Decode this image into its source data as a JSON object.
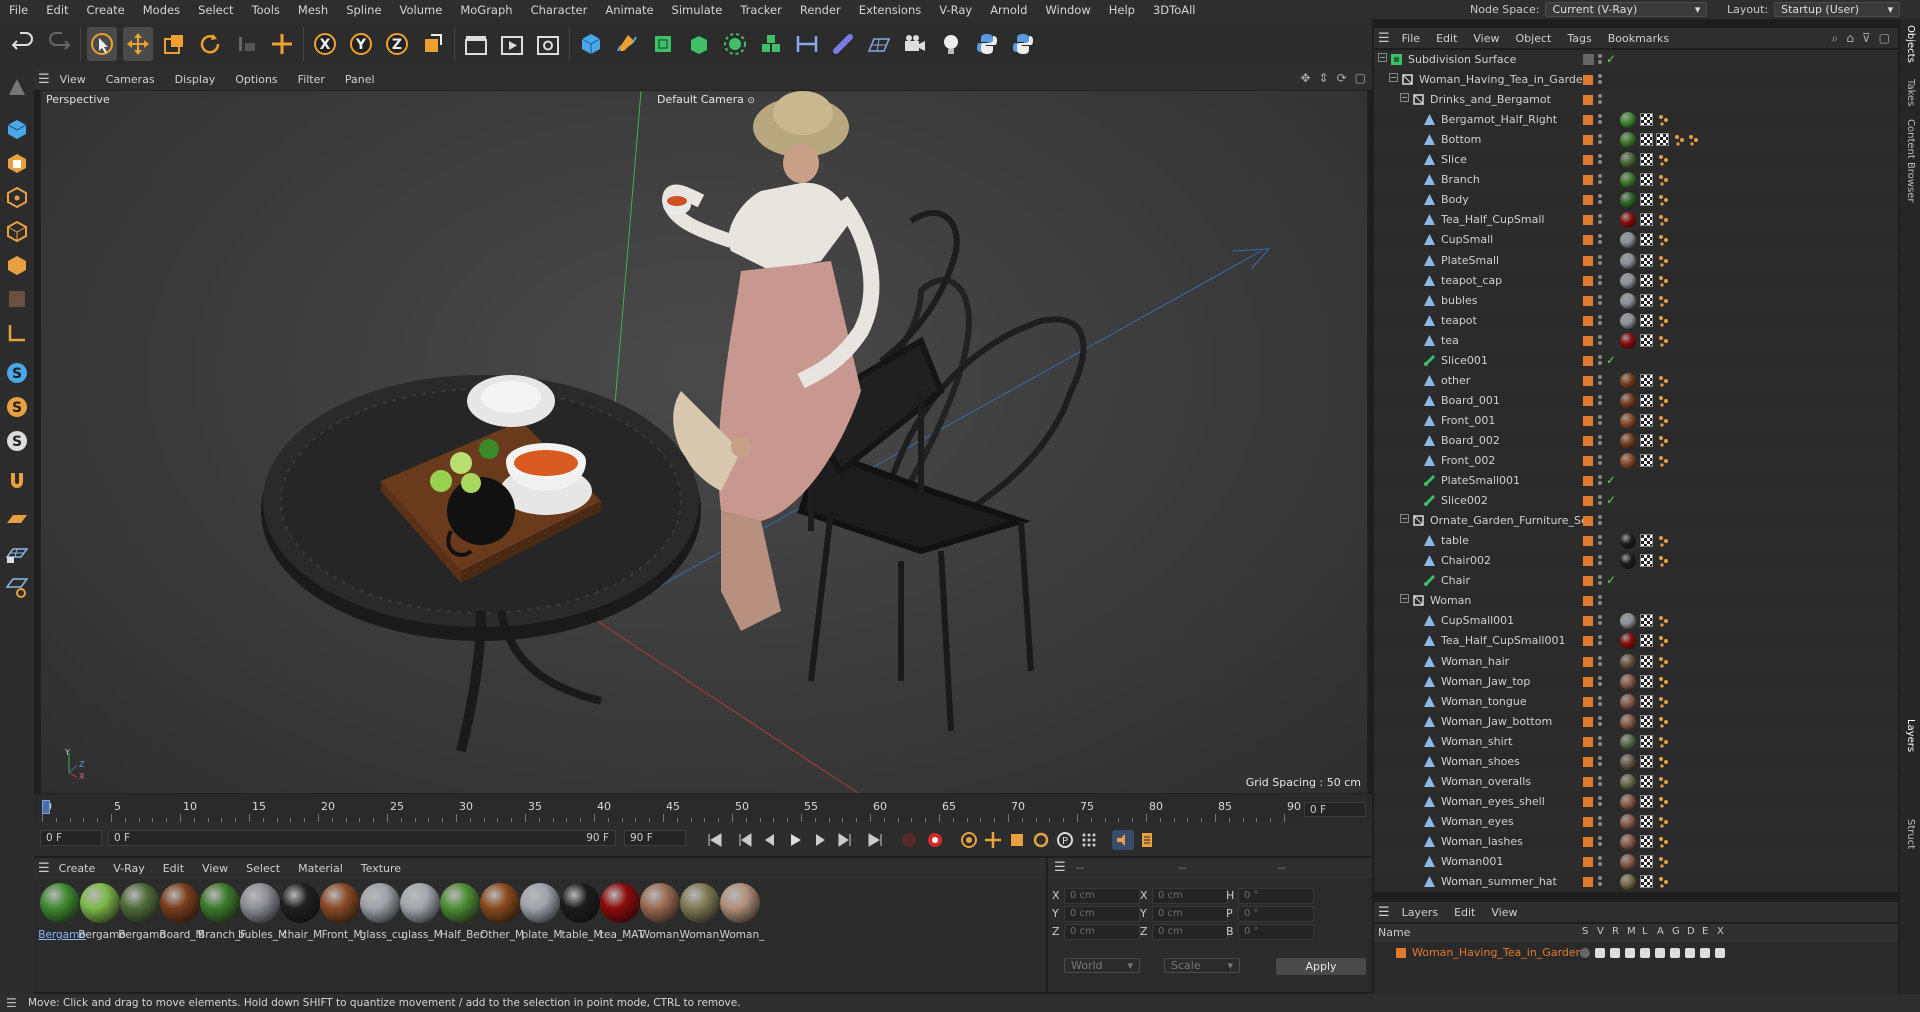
{
  "menubar": {
    "items": [
      "File",
      "Edit",
      "Create",
      "Modes",
      "Select",
      "Tools",
      "Mesh",
      "Spline",
      "Volume",
      "MoGraph",
      "Character",
      "Animate",
      "Simulate",
      "Tracker",
      "Render",
      "Extensions",
      "V-Ray",
      "Arnold",
      "Window",
      "Help",
      "3DToAll"
    ],
    "node_space_label": "Node Space:",
    "node_space_value": "Current (V-Ray)",
    "layout_label": "Layout:",
    "layout_value": "Startup (User)"
  },
  "viewport": {
    "menu": [
      "View",
      "Cameras",
      "Display",
      "Options",
      "Filter",
      "Panel"
    ],
    "label": "Perspective",
    "camera": "Default Camera",
    "grid_spacing": "Grid Spacing : 50 cm"
  },
  "timeline": {
    "ticks": [
      "0",
      "5",
      "10",
      "15",
      "20",
      "25",
      "30",
      "35",
      "40",
      "45",
      "50",
      "55",
      "60",
      "65",
      "70",
      "75",
      "80",
      "85",
      "90"
    ],
    "current_frame": "0 F",
    "start_field": "0 F",
    "range_start": "0 F",
    "range_end": "90 F",
    "end_field": "90 F"
  },
  "materials": {
    "menu": [
      "Create",
      "V-Ray",
      "Edit",
      "View",
      "Select",
      "Material",
      "Texture"
    ],
    "items": [
      {
        "name": "Bergamo",
        "color": "#3f8a2f"
      },
      {
        "name": "Bergamo",
        "color": "#7db84a"
      },
      {
        "name": "Bergamo",
        "color": "#4f6b3a"
      },
      {
        "name": "Board_M",
        "color": "#7a3e1e"
      },
      {
        "name": "Branch_F",
        "color": "#3d7a2c"
      },
      {
        "name": "bubles_M",
        "color": "#8e8e96"
      },
      {
        "name": "chair_M",
        "color": "#202020"
      },
      {
        "name": "Front_M",
        "color": "#8a4a26"
      },
      {
        "name": "glass_cu",
        "color": "#9ea2a8"
      },
      {
        "name": "glass_M",
        "color": "#a4a8ae"
      },
      {
        "name": "Half_Ber",
        "color": "#4e8e34"
      },
      {
        "name": "Other_M",
        "color": "#8a4a1e"
      },
      {
        "name": "plate_M",
        "color": "#a0a4ac"
      },
      {
        "name": "table_M",
        "color": "#1c1c1c"
      },
      {
        "name": "tea_MAT",
        "color": "#8e0a0a"
      },
      {
        "name": "Woman_",
        "color": "#9a6a52"
      },
      {
        "name": "Woman_",
        "color": "#7f7a55"
      },
      {
        "name": "Woman_",
        "color": "#b0907a"
      }
    ]
  },
  "coordinates": {
    "headers": [
      "--",
      "--",
      "--"
    ],
    "rows": [
      {
        "a": "X",
        "av": "0 cm",
        "b": "X",
        "bv": "0 cm",
        "c": "H",
        "cv": "0 °"
      },
      {
        "a": "Y",
        "av": "0 cm",
        "b": "Y",
        "bv": "0 cm",
        "c": "P",
        "cv": "0 °"
      },
      {
        "a": "Z",
        "av": "0 cm",
        "b": "Z",
        "bv": "0 cm",
        "c": "B",
        "cv": "0 °"
      }
    ],
    "world": "World",
    "scale": "Scale",
    "apply": "Apply"
  },
  "status": "Move: Click and drag to move elements. Hold down SHIFT to quantize movement / add to the selection in point mode, CTRL to remove.",
  "object_manager": {
    "menu": [
      "File",
      "Edit",
      "View",
      "Object",
      "Tags",
      "Bookmarks"
    ],
    "rows": [
      {
        "label": "Subdivision Surface",
        "indent": 0,
        "type": "subd",
        "tags": []
      },
      {
        "label": "Woman_Having_Tea_in_Garden",
        "indent": 1,
        "type": "null",
        "tags": []
      },
      {
        "label": "Drinks_and_Bergamot",
        "indent": 2,
        "type": "null",
        "tags": []
      },
      {
        "label": "Bergamot_Half_Right",
        "indent": 3,
        "type": "poly",
        "tags": [
          "#3f8a2f"
        ]
      },
      {
        "label": "Bottom",
        "indent": 3,
        "type": "poly",
        "tags": [
          "#3d7a2c"
        ],
        "extra": true
      },
      {
        "label": "Slice",
        "indent": 3,
        "type": "poly",
        "tags": [
          "#4e6b3a"
        ]
      },
      {
        "label": "Branch",
        "indent": 3,
        "type": "poly",
        "tags": [
          "#3d7a2c"
        ]
      },
      {
        "label": "Body",
        "indent": 3,
        "type": "poly",
        "tags": [
          "#2f6a2a"
        ]
      },
      {
        "label": "Tea_Half_CupSmall",
        "indent": 3,
        "type": "poly",
        "tags": [
          "#8e0a0a"
        ]
      },
      {
        "label": "CupSmall",
        "indent": 3,
        "type": "poly",
        "tags": [
          "#8e9098"
        ]
      },
      {
        "label": "PlateSmall",
        "indent": 3,
        "type": "poly",
        "tags": [
          "#8e9098"
        ]
      },
      {
        "label": "teapot_cap",
        "indent": 3,
        "type": "poly",
        "tags": [
          "#8e9098"
        ]
      },
      {
        "label": "bubles",
        "indent": 3,
        "type": "poly",
        "tags": [
          "#8e9098"
        ]
      },
      {
        "label": "teapot",
        "indent": 3,
        "type": "poly",
        "tags": [
          "#8e9098"
        ]
      },
      {
        "label": "tea",
        "indent": 3,
        "type": "poly",
        "tags": [
          "#8e0a0a"
        ]
      },
      {
        "label": "Slice001",
        "indent": 3,
        "type": "inst",
        "tags": [],
        "check": true
      },
      {
        "label": "other",
        "indent": 3,
        "type": "poly",
        "tags": [
          "#7a3e1e"
        ]
      },
      {
        "label": "Board_001",
        "indent": 3,
        "type": "poly",
        "tags": [
          "#7a3e1e"
        ]
      },
      {
        "label": "Front_001",
        "indent": 3,
        "type": "poly",
        "tags": [
          "#8a4a26"
        ]
      },
      {
        "label": "Board_002",
        "indent": 3,
        "type": "poly",
        "tags": [
          "#7a3e1e"
        ]
      },
      {
        "label": "Front_002",
        "indent": 3,
        "type": "poly",
        "tags": [
          "#8a4a26"
        ]
      },
      {
        "label": "PlateSmall001",
        "indent": 3,
        "type": "inst",
        "tags": [],
        "check": true
      },
      {
        "label": "Slice002",
        "indent": 3,
        "type": "inst",
        "tags": [],
        "check": true
      },
      {
        "label": "Ornate_Garden_Furniture_Set",
        "indent": 2,
        "type": "null",
        "tags": []
      },
      {
        "label": "table",
        "indent": 3,
        "type": "poly",
        "tags": [
          "#1c1c1c"
        ]
      },
      {
        "label": "Chair002",
        "indent": 3,
        "type": "poly",
        "tags": [
          "#1c1c1c"
        ]
      },
      {
        "label": "Chair",
        "indent": 3,
        "type": "inst",
        "tags": [],
        "check": true
      },
      {
        "label": "Woman",
        "indent": 2,
        "type": "null",
        "tags": []
      },
      {
        "label": "CupSmall001",
        "indent": 3,
        "type": "poly",
        "tags": [
          "#8e9098"
        ]
      },
      {
        "label": "Tea_Half_CupSmall001",
        "indent": 3,
        "type": "poly",
        "tags": [
          "#8e0a0a"
        ]
      },
      {
        "label": "Woman_hair",
        "indent": 3,
        "type": "poly",
        "tags": [
          "#6b5540"
        ]
      },
      {
        "label": "Woman_Jaw_top",
        "indent": 3,
        "type": "poly",
        "tags": [
          "#8a5a4a"
        ]
      },
      {
        "label": "Woman_tongue",
        "indent": 3,
        "type": "poly",
        "tags": [
          "#8a5a4a"
        ]
      },
      {
        "label": "Woman_Jaw_bottom",
        "indent": 3,
        "type": "poly",
        "tags": [
          "#8a5a4a"
        ]
      },
      {
        "label": "Woman_shirt",
        "indent": 3,
        "type": "poly",
        "tags": [
          "#5a6a4a"
        ]
      },
      {
        "label": "Woman_shoes",
        "indent": 3,
        "type": "poly",
        "tags": [
          "#6a5a4a"
        ]
      },
      {
        "label": "Woman_overalls",
        "indent": 3,
        "type": "poly",
        "tags": [
          "#6a6a4a"
        ]
      },
      {
        "label": "Woman_eyes_shell",
        "indent": 3,
        "type": "poly",
        "tags": [
          "#8a5a4a"
        ]
      },
      {
        "label": "Woman_eyes",
        "indent": 3,
        "type": "poly",
        "tags": [
          "#8a5a4a"
        ]
      },
      {
        "label": "Woman_lashes",
        "indent": 3,
        "type": "poly",
        "tags": [
          "#8a5a4a"
        ]
      },
      {
        "label": "Woman001",
        "indent": 3,
        "type": "poly",
        "tags": [
          "#8a5a4a"
        ]
      },
      {
        "label": "Woman_summer_hat",
        "indent": 3,
        "type": "poly",
        "tags": [
          "#7a6a4a"
        ]
      }
    ]
  },
  "layers": {
    "menu": [
      "Layers",
      "Edit",
      "View"
    ],
    "name_header": "Name",
    "col_headers": [
      "S",
      "V",
      "R",
      "M",
      "L",
      "A",
      "G",
      "D",
      "E",
      "X"
    ],
    "item": "Woman_Having_Tea_in_Garden"
  },
  "right_tabs": [
    "Objects",
    "Takes",
    "Content Browser",
    "Layers",
    "Struct"
  ]
}
